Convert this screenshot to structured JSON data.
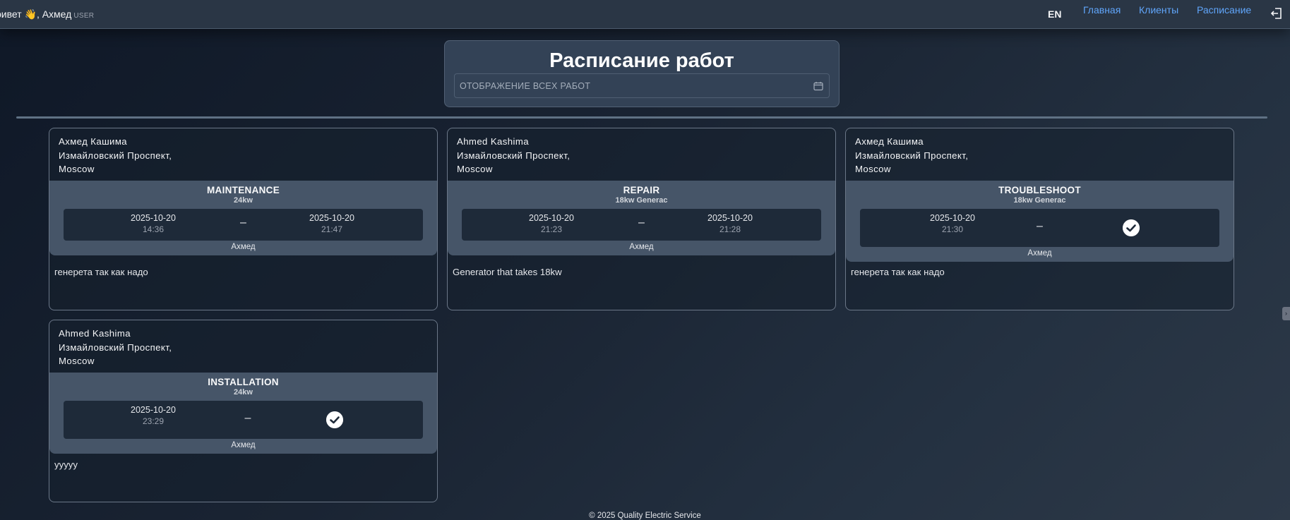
{
  "header": {
    "greeting": "ривет 👋, Ахмед",
    "role": "USER",
    "lang": "EN",
    "nav": [
      {
        "label": "Главная"
      },
      {
        "label": "Клиенты"
      },
      {
        "label": "Расписание"
      }
    ],
    "accent_color": "#60a5fa"
  },
  "page": {
    "title": "Расписание работ",
    "filter_label": "ОТОБРАЖЕНИЕ ВСЕХ РАБОТ"
  },
  "jobs": [
    {
      "client_name": "Ахмед Кашима",
      "address_line1": "Измайловский Проспект,",
      "address_line2": "Moscow",
      "type": "MAINTENANCE",
      "model": "24kw",
      "start_date": "2025-10-20",
      "start_time": "14:36",
      "separator": "–",
      "end_date": "2025-10-20",
      "end_time": "21:47",
      "technician": "Ахмед",
      "note": "генерета так как надо",
      "completed": false
    },
    {
      "client_name": "Ahmed Kashima",
      "address_line1": "Измайловский Проспект,",
      "address_line2": "Moscow",
      "type": "REPAIR",
      "model": "18kw Generac",
      "start_date": "2025-10-20",
      "start_time": "21:23",
      "separator": "–",
      "end_date": "2025-10-20",
      "end_time": "21:28",
      "technician": "Ахмед",
      "note": "Generator that takes 18kw",
      "completed": false
    },
    {
      "client_name": "Ахмед Кашима",
      "address_line1": "Измайловский Проспект,",
      "address_line2": "Moscow",
      "type": "TROUBLESHOOT",
      "model": "18kw Generac",
      "start_date": "2025-10-20",
      "start_time": "21:30",
      "separator": "–",
      "technician": "Ахмед",
      "note": "генерета так как надо",
      "completed": true,
      "status_icon": "check-circle-icon"
    },
    {
      "client_name": "Ahmed Kashima",
      "address_line1": "Измайловский Проспект,",
      "address_line2": "Moscow",
      "type": "INSTALLATION",
      "model": "24kw",
      "start_date": "2025-10-20",
      "start_time": "23:29",
      "separator": "–",
      "technician": "Ахмед",
      "note": "yyyyy",
      "completed": true,
      "status_icon": "check-circle-icon"
    }
  ],
  "footer": {
    "copyright": "© 2025 Quality Electric Service"
  }
}
